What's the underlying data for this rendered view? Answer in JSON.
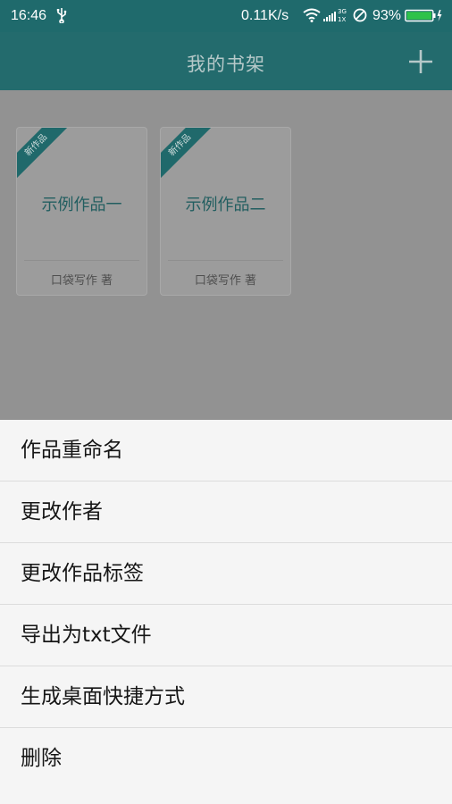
{
  "status_bar": {
    "time": "16:46",
    "net_speed": "0.11K/s",
    "battery_percent": "93%",
    "signal_labels": [
      "3G",
      "1X"
    ],
    "icons": [
      "usb-icon",
      "wifi-icon",
      "signal-icon",
      "do-not-disturb-icon",
      "battery-charging-icon"
    ]
  },
  "app_bar": {
    "title": "我的书架",
    "add_icon": "plus-icon"
  },
  "books": [
    {
      "badge": "新作品",
      "title": "示例作品一",
      "author": "口袋写作 著"
    },
    {
      "badge": "新作品",
      "title": "示例作品二",
      "author": "口袋写作 著"
    }
  ],
  "menu": {
    "items": [
      {
        "label": "作品重命名"
      },
      {
        "label": "更改作者"
      },
      {
        "label": "更改作品标签"
      },
      {
        "label": "导出为txt文件"
      },
      {
        "label": "生成桌面快捷方式"
      },
      {
        "label": "删除"
      }
    ]
  },
  "colors": {
    "status_bar_bg": "#1f6a6c",
    "app_bar_bg": "#236b6d",
    "accent": "#20696b",
    "scrim": "#929292",
    "sheet_bg": "#f5f5f5",
    "battery_fill": "#2ec24a"
  }
}
